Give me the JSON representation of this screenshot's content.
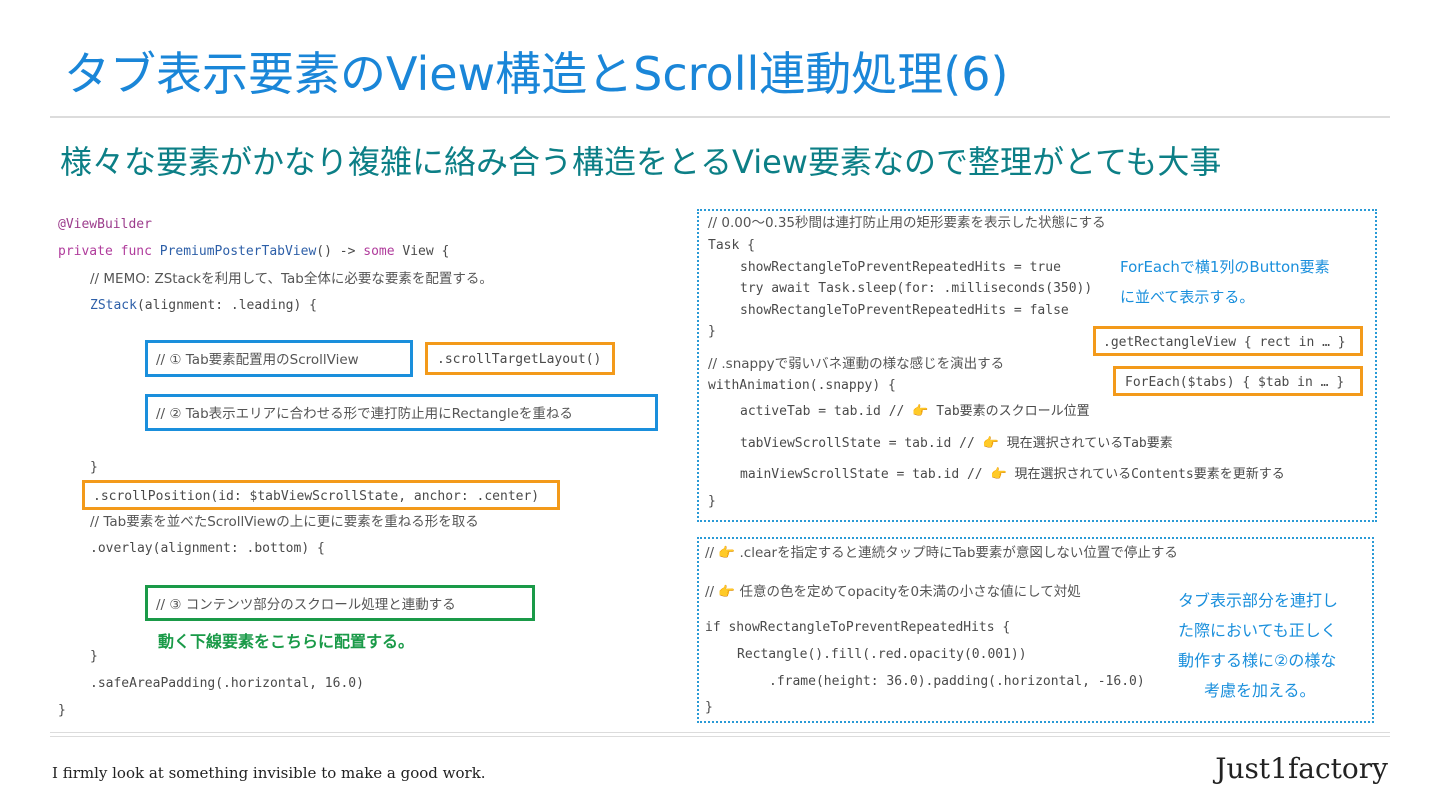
{
  "title": "タブ表示要素のView構造とScroll連動処理(6)",
  "subtitle": "様々な要素がかなり複雑に絡み合う構造をとるView要素なので整理がとても大事",
  "left_code": {
    "l1": "@ViewBuilder",
    "l2a": "private func ",
    "l2b": "PremiumPosterTabView",
    "l2c": "() -> ",
    "l2d": "some",
    "l2e": " View {",
    "l3": "// MEMO: ZStackを利用して、Tab全体に必要な要素を配置する。",
    "l4a": "ZStack",
    "l4b": "(alignment: .leading) {",
    "box1": "// ① Tab要素配置用のScrollView",
    "box1b": ".scrollTargetLayout()",
    "box2": "// ② Tab表示エリアに合わせる形で連打防止用にRectangleを重ねる",
    "close1": "}",
    "l5": ".scrollPosition(id: $tabViewScrollState, anchor: .center)",
    "l6": "// Tab要素を並べたScrollViewの上に更に要素を重ねる形を取る",
    "l7": ".overlay(alignment: .bottom) {",
    "box3": "// ③ コンテンツ部分のスクロール処理と連動する",
    "green_note": "動く下線要素をこちらに配置する。",
    "close2": "}",
    "l8": ".safeAreaPadding(.horizontal, 16.0)",
    "close3": "}"
  },
  "right_top": {
    "c1": "// 0.00〜0.35秒間は連打防止用の矩形要素を表示した状態にする",
    "c2": "Task {",
    "c3": "showRectangleToPreventRepeatedHits = true",
    "c4": "try await Task.sleep(for: .milliseconds(350))",
    "c5": "showRectangleToPreventRepeatedHits = false",
    "c6": "}",
    "c7": "// .snappyで弱いバネ運動の様な感じを演出する",
    "c8": "withAnimation(.snappy) {",
    "c9": "activeTab = tab.id // 👉 Tab要素のスクロール位置",
    "c10": "tabViewScrollState = tab.id // 👉 現在選択されているTab要素",
    "c11": "mainViewScrollState = tab.id // 👉 現在選択されているContents要素を更新する",
    "c12": "}",
    "note1": "ForEachで横1列のButton要素",
    "note2": "に並べて表示する。",
    "box_a": ".getRectangleView { rect in … }",
    "box_b": "ForEach($tabs) { $tab in … }"
  },
  "right_bottom": {
    "c1": "// 👉 .clearを指定すると連続タップ時にTab要素が意図しない位置で停止する",
    "c2": "// 👉 任意の色を定めてopacityを0未満の小さな値にして対処",
    "c3": "if showRectangleToPreventRepeatedHits {",
    "c4": "Rectangle().fill(.red.opacity(0.001))",
    "c5": ".frame(height: 36.0).padding(.horizontal, -16.0)",
    "c6": "}",
    "note1": "タブ表示部分を連打し",
    "note2": "た際においても正しく",
    "note3": "動作する様に②の様な",
    "note4": "考慮を加える。"
  },
  "footer": {
    "left": "I firmly look at something invisible to make a good work.",
    "right": "Just1factory"
  },
  "colors": {
    "title": "#1a86d8",
    "subtitle": "#0c7f86",
    "blue_box": "#1a8fdc",
    "orange_box": "#f39a1a",
    "green_box": "#1a9a48"
  }
}
